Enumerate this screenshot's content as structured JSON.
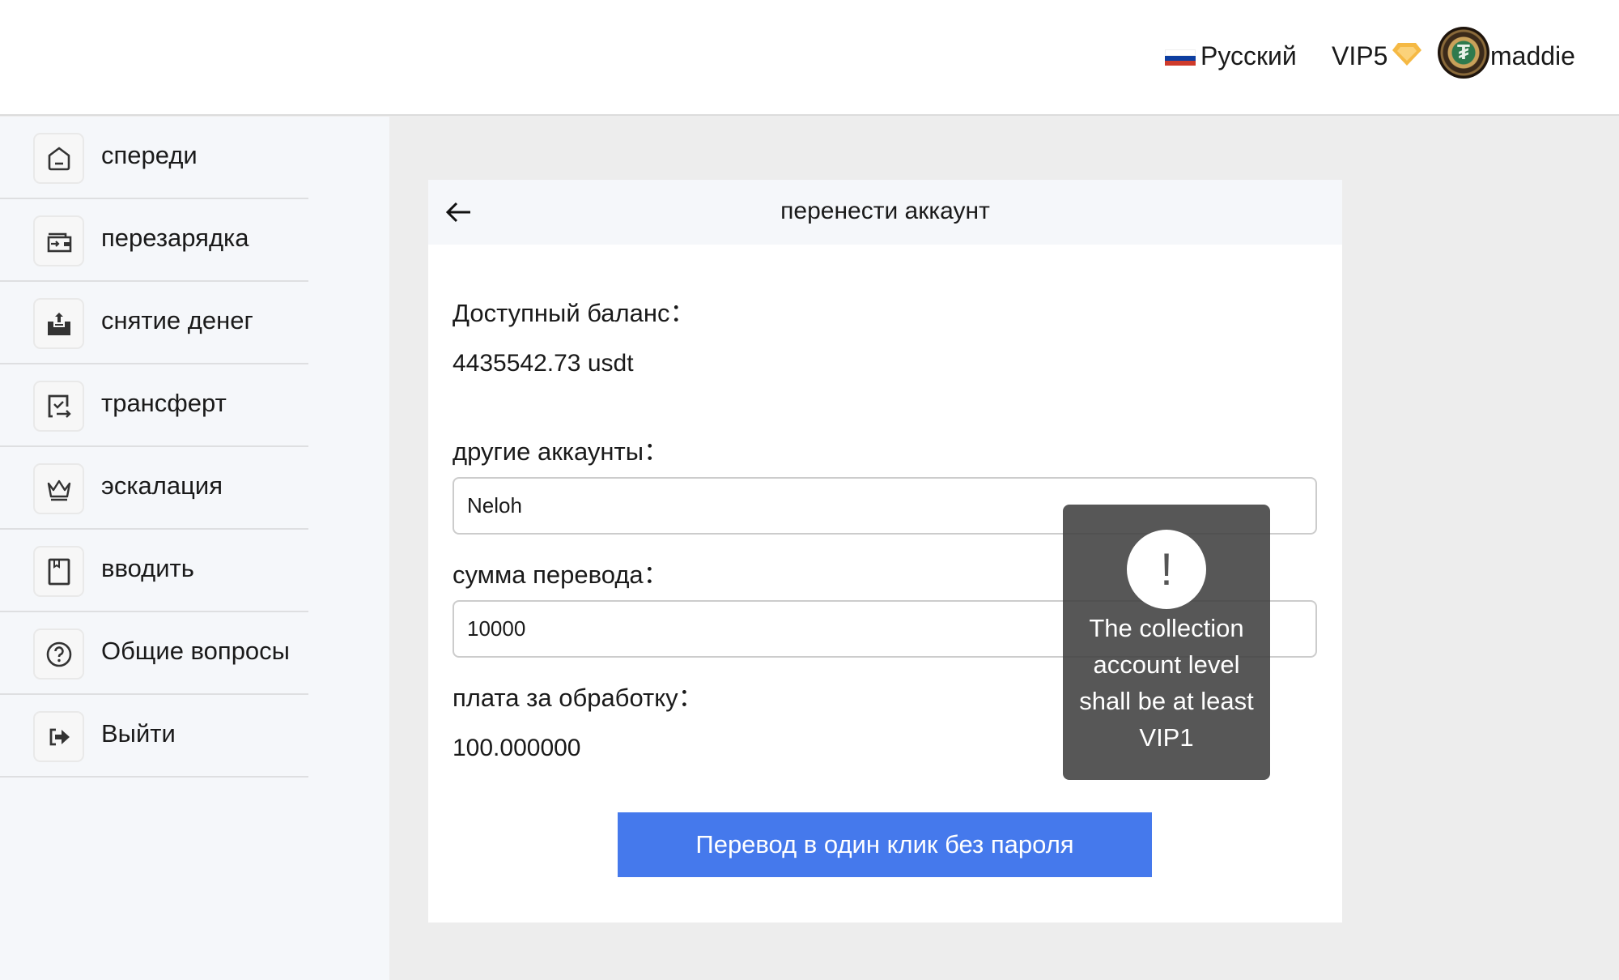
{
  "header": {
    "language": "Русский",
    "flag_colors": [
      "#ffffff",
      "#0d3ea0",
      "#cf3b2b"
    ],
    "vip_level": "VIP5",
    "vip_icon": "diamond-icon",
    "vip_color": "#f5b944",
    "avatar_glyph": "₮",
    "username": "maddie"
  },
  "sidebar": {
    "items": [
      {
        "label": "спереди",
        "icon": "home-icon"
      },
      {
        "label": "перезарядка",
        "icon": "wallet-recharge-icon"
      },
      {
        "label": "снятие денег",
        "icon": "withdraw-upload-icon"
      },
      {
        "label": "трансферт",
        "icon": "transfer-check-icon"
      },
      {
        "label": "эскалация",
        "icon": "crown-icon"
      },
      {
        "label": "вводить",
        "icon": "bookmark-icon"
      },
      {
        "label": "Общие вопросы",
        "icon": "question-circle-icon"
      },
      {
        "label": "Выйти",
        "icon": "logout-icon"
      }
    ]
  },
  "card": {
    "title": "перенести аккаунт",
    "back_icon": "arrow-left-icon",
    "balance_label": "Доступный баланс：",
    "balance_value": "4435542.73 usdt",
    "account_label": "другие аккаунты：",
    "account_value": "Neloh",
    "amount_label": "сумма перевода：",
    "amount_value": "10000",
    "fee_label": "плата за обработку：",
    "fee_value": "100.000000",
    "submit_label": "Перевод в один клик без пароля",
    "accent_color": "#4579ec"
  },
  "toast": {
    "icon_glyph": "!",
    "message": "The collection account level shall be at least VIP1"
  }
}
